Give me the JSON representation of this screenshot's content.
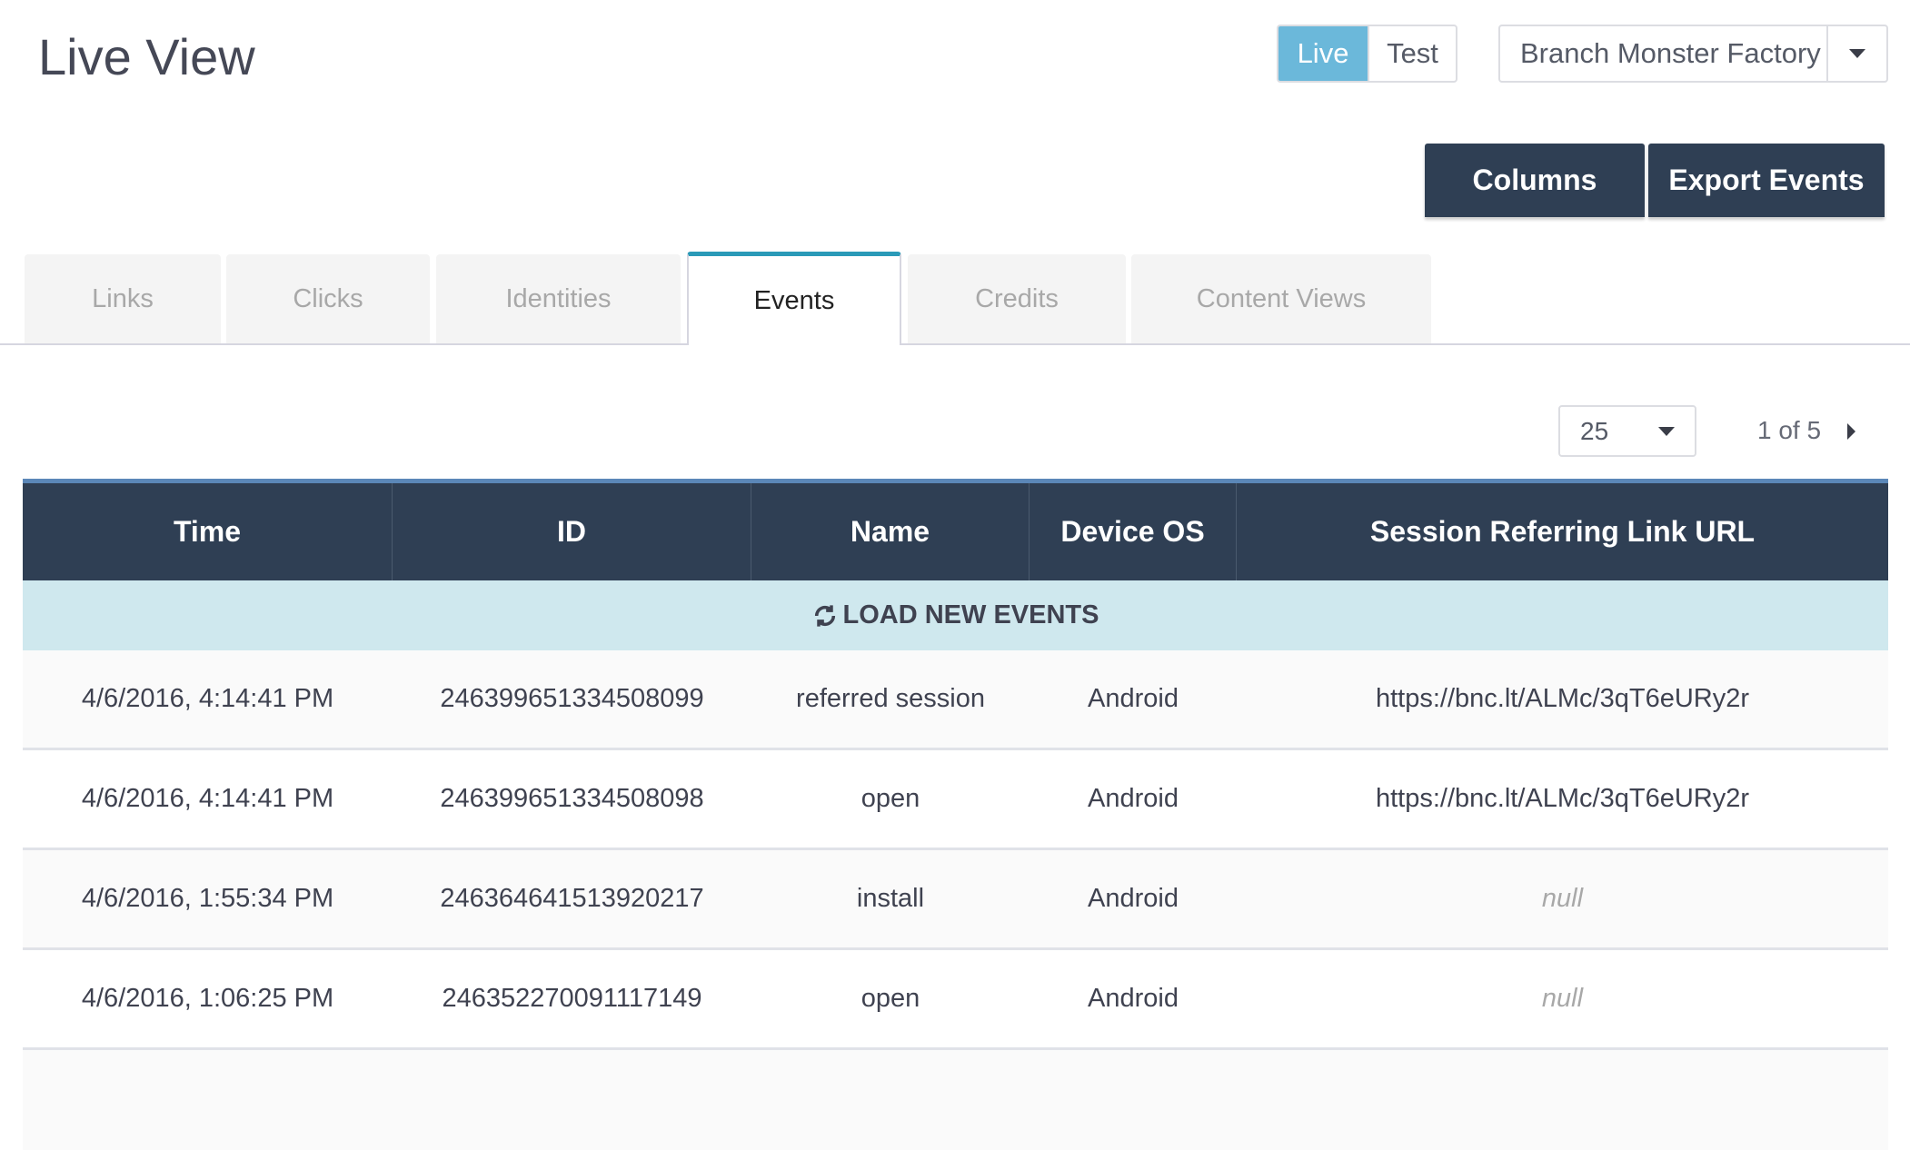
{
  "header": {
    "title": "Live View",
    "env_live": "Live",
    "env_test": "Test",
    "org": "Branch Monster Factory"
  },
  "actions": {
    "columns": "Columns",
    "export": "Export Events"
  },
  "tabs": [
    "Links",
    "Clicks",
    "Identities",
    "Events",
    "Credits",
    "Content Views"
  ],
  "pagination": {
    "per_page": "25",
    "info": "1 of 5"
  },
  "table": {
    "columns": [
      "Time",
      "ID",
      "Name",
      "Device OS",
      "Session Referring Link URL"
    ],
    "load_new": "LOAD NEW EVENTS",
    "rows": [
      [
        "4/6/2016, 4:14:41 PM",
        "246399651334508099",
        "referred session",
        "Android",
        "https://bnc.lt/ALMc/3qT6eURy2r"
      ],
      [
        "4/6/2016, 4:14:41 PM",
        "246399651334508098",
        "open",
        "Android",
        "https://bnc.lt/ALMc/3qT6eURy2r"
      ],
      [
        "4/6/2016, 1:55:34 PM",
        "246364641513920217",
        "install",
        "Android",
        "null"
      ],
      [
        "4/6/2016, 1:06:25 PM",
        "246352270091117149",
        "open",
        "Android",
        "null"
      ]
    ]
  }
}
